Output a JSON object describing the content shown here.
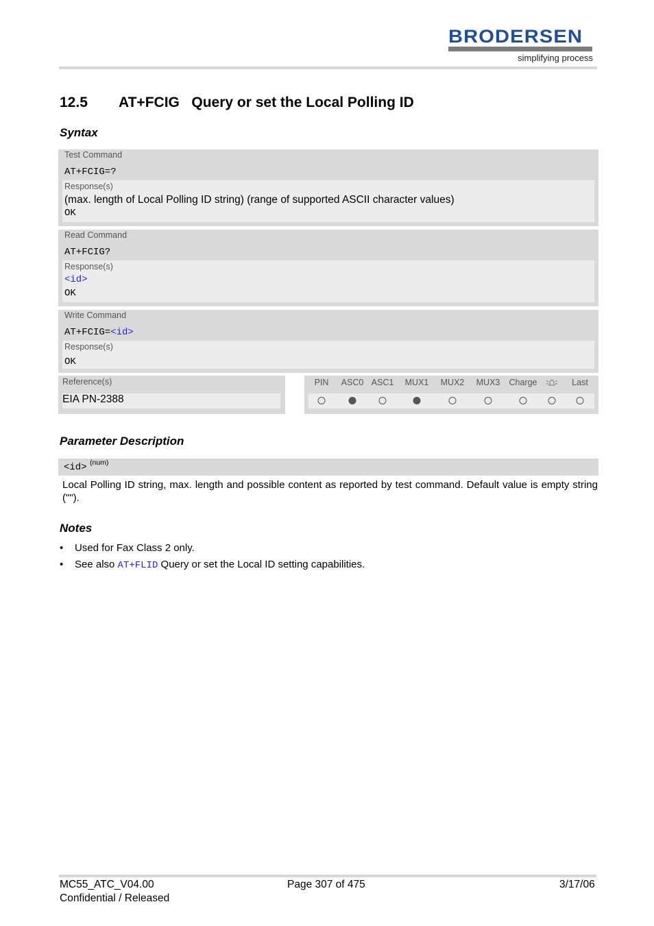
{
  "header": {
    "brand": "BRODERSEN",
    "tagline": "simplifying process",
    "brand_color": "#1d4f9c"
  },
  "section": {
    "number": "12.5",
    "title": "AT+FCIG   Query or set the Local Polling ID"
  },
  "syntax": {
    "heading": "Syntax",
    "test": {
      "label": "Test Command",
      "command": "AT+FCIG=?",
      "response_label": "Response(s)",
      "response_line": "(max. length of Local Polling ID string) (range of supported ASCII character values)",
      "ok": "OK"
    },
    "read": {
      "label": "Read Command",
      "command": "AT+FCIG?",
      "response_label": "Response(s)",
      "response_param": "<id>",
      "ok": "OK"
    },
    "write": {
      "label": "Write Command",
      "command_prefix": "AT+FCIG=",
      "command_param": "<id>",
      "response_label": "Response(s)",
      "ok": "OK"
    },
    "reference": {
      "label": "Reference(s)",
      "value": "EIA PN-2388"
    },
    "flags": [
      {
        "name": "PIN",
        "supported": false
      },
      {
        "name": "ASC0",
        "supported": true
      },
      {
        "name": "ASC1",
        "supported": false
      },
      {
        "name": "MUX1",
        "supported": true
      },
      {
        "name": "MUX2",
        "supported": false
      },
      {
        "name": "MUX3",
        "supported": false
      },
      {
        "name": "Charge",
        "supported": false
      },
      {
        "name": "alarm-icon",
        "supported": false
      },
      {
        "name": "Last",
        "supported": false
      }
    ]
  },
  "parameters": {
    "heading": "Parameter Description",
    "items": [
      {
        "name": "<id>",
        "type": "(num)",
        "description": "Local Polling ID string, max. length and possible content as reported by test command. Default value is empty string (\"\")."
      }
    ]
  },
  "notes": {
    "heading": "Notes",
    "bullet": "•",
    "items": [
      {
        "text": "Used for Fax Class 2 only."
      },
      {
        "prefix": "See also ",
        "link": "AT+FLID",
        "suffix": " Query or set the Local ID setting capabilities."
      }
    ]
  },
  "footer": {
    "doc_id": "MC55_ATC_V04.00",
    "status": "Confidential / Released",
    "page": "Page 307 of 475",
    "date": "3/17/06"
  }
}
